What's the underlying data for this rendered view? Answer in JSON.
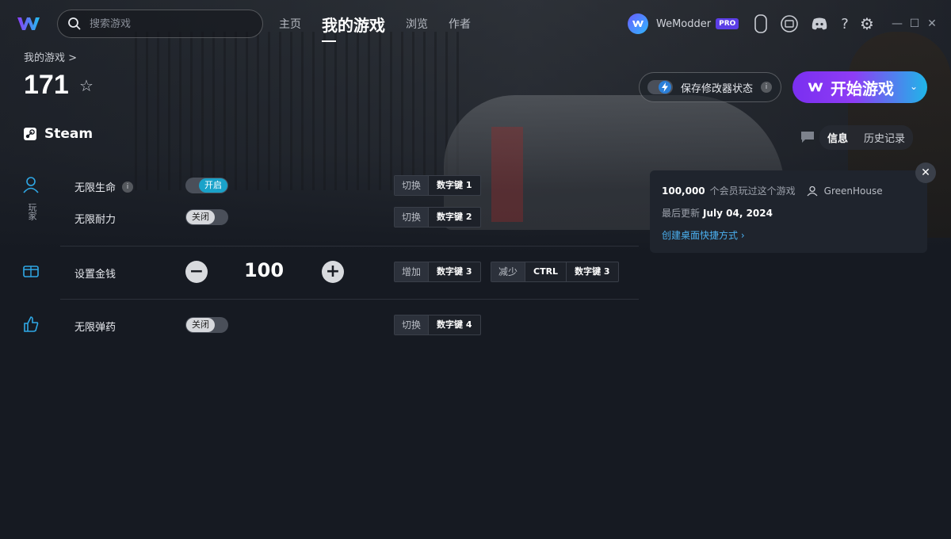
{
  "window": {
    "search_placeholder": "搜索游戏",
    "minimize": "—",
    "maximize": "☐",
    "close": "✕"
  },
  "nav": {
    "items": [
      {
        "label": "主页",
        "active": false
      },
      {
        "label": "我的游戏",
        "active": true
      },
      {
        "label": "浏览",
        "active": false
      },
      {
        "label": "作者",
        "active": false
      }
    ]
  },
  "user": {
    "name": "WeModder",
    "badge": "PRO"
  },
  "icons": {
    "help": "?",
    "settings": "⚙",
    "star": "☆",
    "caret": "⌄",
    "chevron": "›"
  },
  "game": {
    "breadcrumb": "我的游戏 >",
    "title": "171",
    "platform": "Steam"
  },
  "save_mods": {
    "label": "保存修改器状态",
    "info": "i"
  },
  "play": {
    "label": "开始游戏"
  },
  "tabs": {
    "info": "信息",
    "history": "历史记录"
  },
  "info_card": {
    "members_count": "100,000",
    "members_text": "个会员玩过这个游戏",
    "author": "GreenHouse",
    "updated_label": "最后更新",
    "updated_date": "July 04, 2024",
    "shortcut_link": "创建桌面快捷方式 ›",
    "close": "✕"
  },
  "categories": {
    "player": "玩家"
  },
  "cheats": [
    {
      "name": "无限生命",
      "has_info": true,
      "state": "开启",
      "on": true,
      "action": "切换",
      "key": "数字键 1"
    },
    {
      "name": "无限耐力",
      "has_info": false,
      "state": "关闭",
      "on": false,
      "action": "切换",
      "key": "数字键 2"
    },
    {
      "name": "设置金钱",
      "value": "100",
      "minus": "−",
      "plus": "+",
      "inc_action": "增加",
      "inc_key": "数字键 3",
      "dec_action": "减少",
      "dec_mod": "CTRL",
      "dec_key": "数字键 3"
    },
    {
      "name": "无限弹药",
      "state": "关闭",
      "on": false,
      "action": "切换",
      "key": "数字键 4"
    }
  ],
  "colors": {
    "accent_purple": "#7a2ff0",
    "accent_cyan": "#1fb6e8",
    "toggle_on": "#1aa2c9",
    "link": "#4bb0f0"
  }
}
